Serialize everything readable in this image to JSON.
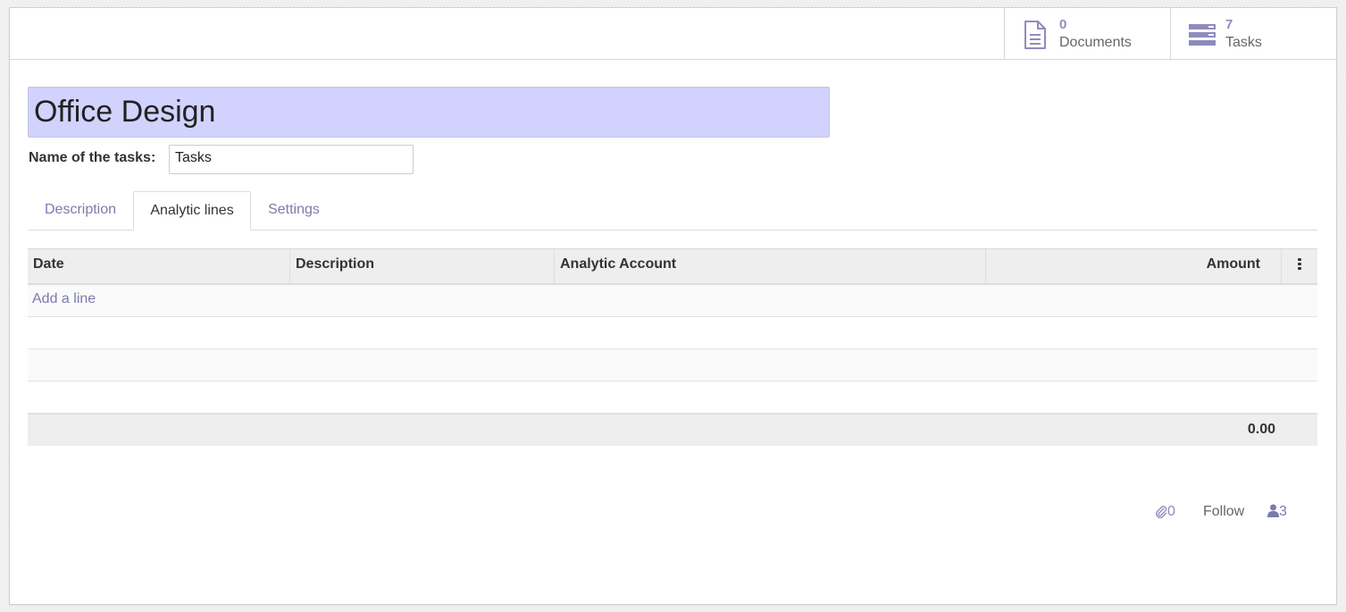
{
  "header": {
    "documents": {
      "count": "0",
      "label": "Documents",
      "icon": "document-icon"
    },
    "tasks": {
      "count": "7",
      "label": "Tasks",
      "icon": "tasks-icon"
    }
  },
  "form": {
    "title": "Office Design",
    "task_name_label": "Name of the tasks:",
    "task_name_value": "Tasks"
  },
  "tabs": [
    {
      "label": "Description",
      "active": false
    },
    {
      "label": "Analytic lines",
      "active": true
    },
    {
      "label": "Settings",
      "active": false
    }
  ],
  "table": {
    "columns": [
      "Date",
      "Description",
      "Analytic Account",
      "Amount"
    ],
    "add_line_label": "Add a line",
    "total": "0.00"
  },
  "chatter": {
    "attachments": "0",
    "follow_label": "Follow",
    "followers": "3"
  },
  "colors": {
    "accent": "#7c7bad",
    "title_bg": "#d2d2ff"
  }
}
